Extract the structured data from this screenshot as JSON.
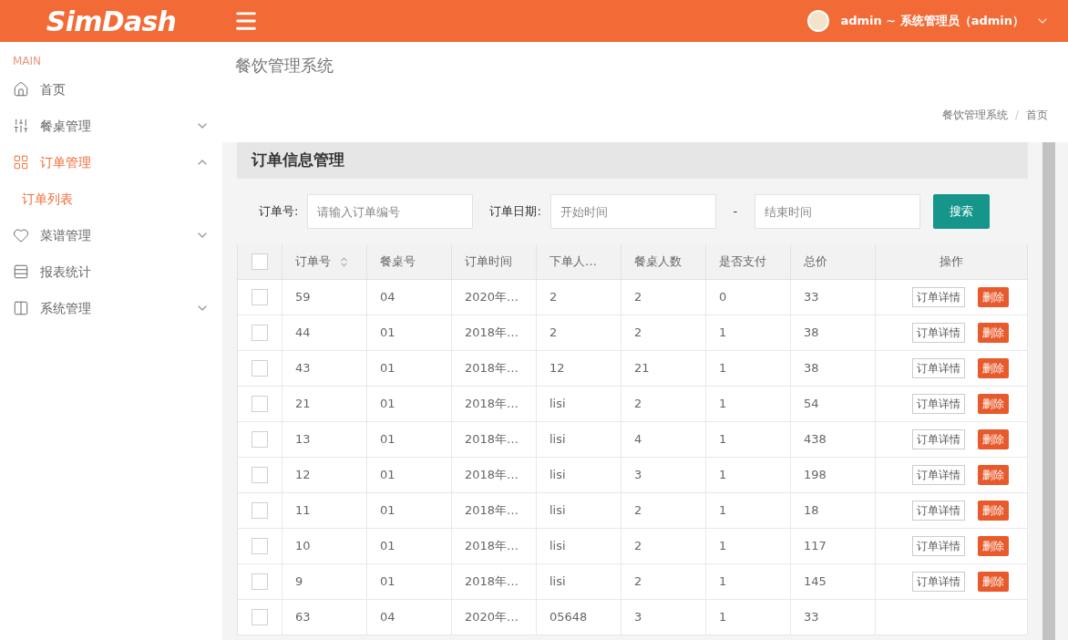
{
  "header": {
    "logo": "SimDash",
    "user": "admin ~ 系统管理员（admin）"
  },
  "sidebar": {
    "section": "MAIN",
    "items": [
      {
        "label": "首页",
        "kind": "home",
        "selected": false
      },
      {
        "label": "餐桌管理",
        "kind": "table",
        "selected": false,
        "expanded": false
      },
      {
        "label": "订单管理",
        "kind": "grid",
        "selected": true,
        "expanded": true,
        "children": [
          {
            "label": "订单列表",
            "selected": true
          }
        ]
      },
      {
        "label": "菜谱管理",
        "kind": "heart",
        "selected": false,
        "expanded": false
      },
      {
        "label": "报表统计",
        "kind": "report",
        "selected": false
      },
      {
        "label": "系统管理",
        "kind": "layout",
        "selected": false,
        "expanded": false
      }
    ]
  },
  "page_title": "餐饮管理系统",
  "breadcrumb": {
    "items": [
      "餐饮管理系统",
      "首页"
    ],
    "separator": "/"
  },
  "panel": {
    "title": "订单信息管理",
    "filters": {
      "order_label": "订单号:",
      "order_placeholder": "请输入订单编号",
      "date_label": "订单日期:",
      "start_placeholder": "开始时间",
      "separator": "-",
      "end_placeholder": "结束时间",
      "search_button": "搜索"
    },
    "table": {
      "header_checked": false,
      "columns": [
        "订单号",
        "餐桌号",
        "订单时间",
        "下单人…",
        "餐桌人数",
        "是否支付",
        "总价",
        "操作"
      ],
      "rows": [
        {
          "checked": false,
          "cells": [
            "59",
            "04",
            "2020年…",
            "2",
            "2",
            "0",
            "33"
          ],
          "actions": [
            "订单详情",
            "删除"
          ]
        },
        {
          "checked": false,
          "cells": [
            "44",
            "01",
            "2018年…",
            "2",
            "2",
            "1",
            "38"
          ],
          "actions": [
            "订单详情",
            "删除"
          ]
        },
        {
          "checked": false,
          "cells": [
            "43",
            "01",
            "2018年…",
            "12",
            "21",
            "1",
            "38"
          ],
          "actions": [
            "订单详情",
            "删除"
          ]
        },
        {
          "checked": false,
          "cells": [
            "21",
            "01",
            "2018年…",
            "lisi",
            "2",
            "1",
            "54"
          ],
          "actions": [
            "订单详情",
            "删除"
          ]
        },
        {
          "checked": false,
          "cells": [
            "13",
            "01",
            "2018年…",
            "lisi",
            "4",
            "1",
            "438"
          ],
          "actions": [
            "订单详情",
            "删除"
          ]
        },
        {
          "checked": false,
          "cells": [
            "12",
            "01",
            "2018年…",
            "lisi",
            "3",
            "1",
            "198"
          ],
          "actions": [
            "订单详情",
            "删除"
          ]
        },
        {
          "checked": false,
          "cells": [
            "11",
            "01",
            "2018年…",
            "lisi",
            "2",
            "1",
            "18"
          ],
          "actions": [
            "订单详情",
            "删除"
          ]
        },
        {
          "checked": false,
          "cells": [
            "10",
            "01",
            "2018年…",
            "lisi",
            "2",
            "1",
            "117"
          ],
          "actions": [
            "订单详情",
            "删除"
          ]
        },
        {
          "checked": false,
          "cells": [
            "9",
            "01",
            "2018年…",
            "lisi",
            "2",
            "1",
            "145"
          ],
          "actions": [
            "订单详情",
            "删除"
          ]
        },
        {
          "checked": false,
          "cells": [
            "63",
            "04",
            "2020年…",
            "05648",
            "3",
            "1",
            "33"
          ],
          "actions": []
        }
      ]
    }
  }
}
